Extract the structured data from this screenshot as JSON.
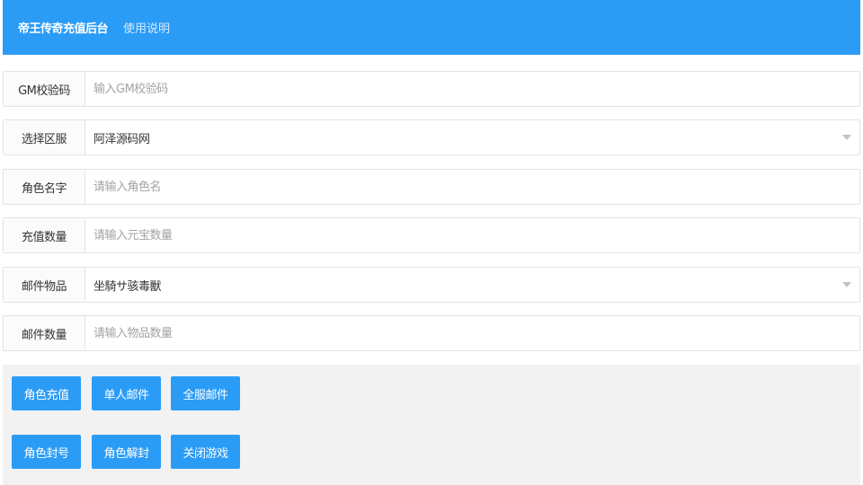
{
  "header": {
    "title": "帝王传奇充值后台",
    "help_link": "使用说明"
  },
  "form": {
    "gm_code": {
      "label": "GM校验码",
      "placeholder": "输入GM校验码",
      "value": ""
    },
    "zone": {
      "label": "选择区服",
      "selected": "阿泽源码网"
    },
    "role_name": {
      "label": "角色名字",
      "placeholder": "请输入角色名",
      "value": ""
    },
    "recharge_amount": {
      "label": "充值数量",
      "placeholder": "请输入元宝数量",
      "value": ""
    },
    "mail_item": {
      "label": "邮件物品",
      "selected": "坐騎サ骇毒獸"
    },
    "mail_count": {
      "label": "邮件数量",
      "placeholder": "请输入物品数量",
      "value": ""
    }
  },
  "actions": {
    "row1": [
      "角色充值",
      "单人邮件",
      "全服邮件"
    ],
    "row2": [
      "角色封号",
      "角色解封",
      "关闭游戏"
    ]
  },
  "colors": {
    "primary": "#2b9cf6",
    "panel_bg": "#f2f2f2",
    "border": "#e3e3e3"
  }
}
